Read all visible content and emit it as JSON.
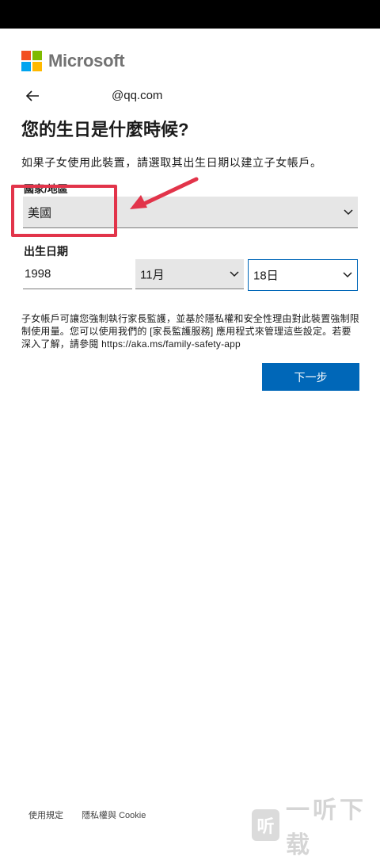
{
  "brand": {
    "name": "Microsoft",
    "colors": [
      "#f25022",
      "#7fba00",
      "#00a4ef",
      "#ffb900"
    ]
  },
  "account": {
    "email": "@qq.com"
  },
  "page": {
    "title": "您的生日是什麼時候?",
    "description": "如果子女使用此裝置，請選取其出生日期以建立子女帳戶。"
  },
  "country": {
    "label": "國家/地區",
    "value": "美國"
  },
  "dob": {
    "label": "出生日期",
    "year": "1998",
    "month": "11月",
    "day": "18日"
  },
  "info_text": "子女帳戶可讓您強制執行家長監護，並基於隱私權和安全性理由對此裝置強制限制使用量。您可以使用我們的 [家長監護服務] 應用程式來管理這些設定。若要深入了解，請參閱 https://aka.ms/family-safety-app",
  "next_button": "下一步",
  "footer": {
    "terms": "使用規定",
    "privacy": "隱私權與 Cookie"
  },
  "watermark": {
    "icon_char": "听",
    "text": "一听下载"
  },
  "colors": {
    "accent": "#0067b8",
    "annotation": "#e2344a"
  }
}
